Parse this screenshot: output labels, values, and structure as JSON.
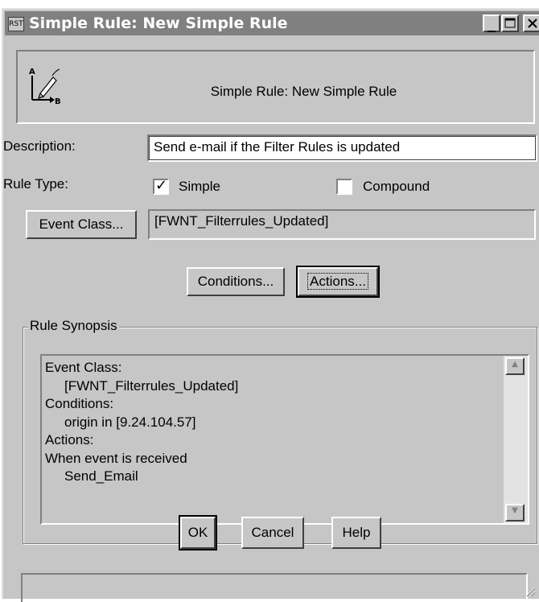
{
  "window": {
    "title": "Simple Rule: New Simple Rule",
    "app_icon_text": "RST",
    "controls": {
      "minimize": "_",
      "maximize": "□",
      "close": "✕"
    }
  },
  "header": {
    "icon": "rule-a-to-b-icon",
    "title": "Simple Rule: New Simple Rule"
  },
  "form": {
    "description_label": "Description:",
    "description_value": "Send e-mail if the Filter Rules is updated",
    "rule_type_label": "Rule Type:",
    "rule_types": [
      {
        "label": "Simple",
        "checked": true
      },
      {
        "label": "Compound",
        "checked": false
      }
    ],
    "event_class_button": "Event Class...",
    "event_class_value": "[FWNT_Filterrules_Updated]"
  },
  "buttons": {
    "conditions": "Conditions...",
    "actions": "Actions...",
    "ok": "OK",
    "cancel": "Cancel",
    "help": "Help"
  },
  "synopsis": {
    "legend": "Rule Synopsis",
    "lines": [
      "Event Class:",
      "[FWNT_Filterrules_Updated]",
      "Conditions:",
      "origin in [9.24.104.57]",
      "Actions:",
      "When event is received",
      "Send_Email"
    ]
  },
  "colors": {
    "face": "#c6c6c6",
    "titlebar": "#808080",
    "field": "#ffffff"
  }
}
